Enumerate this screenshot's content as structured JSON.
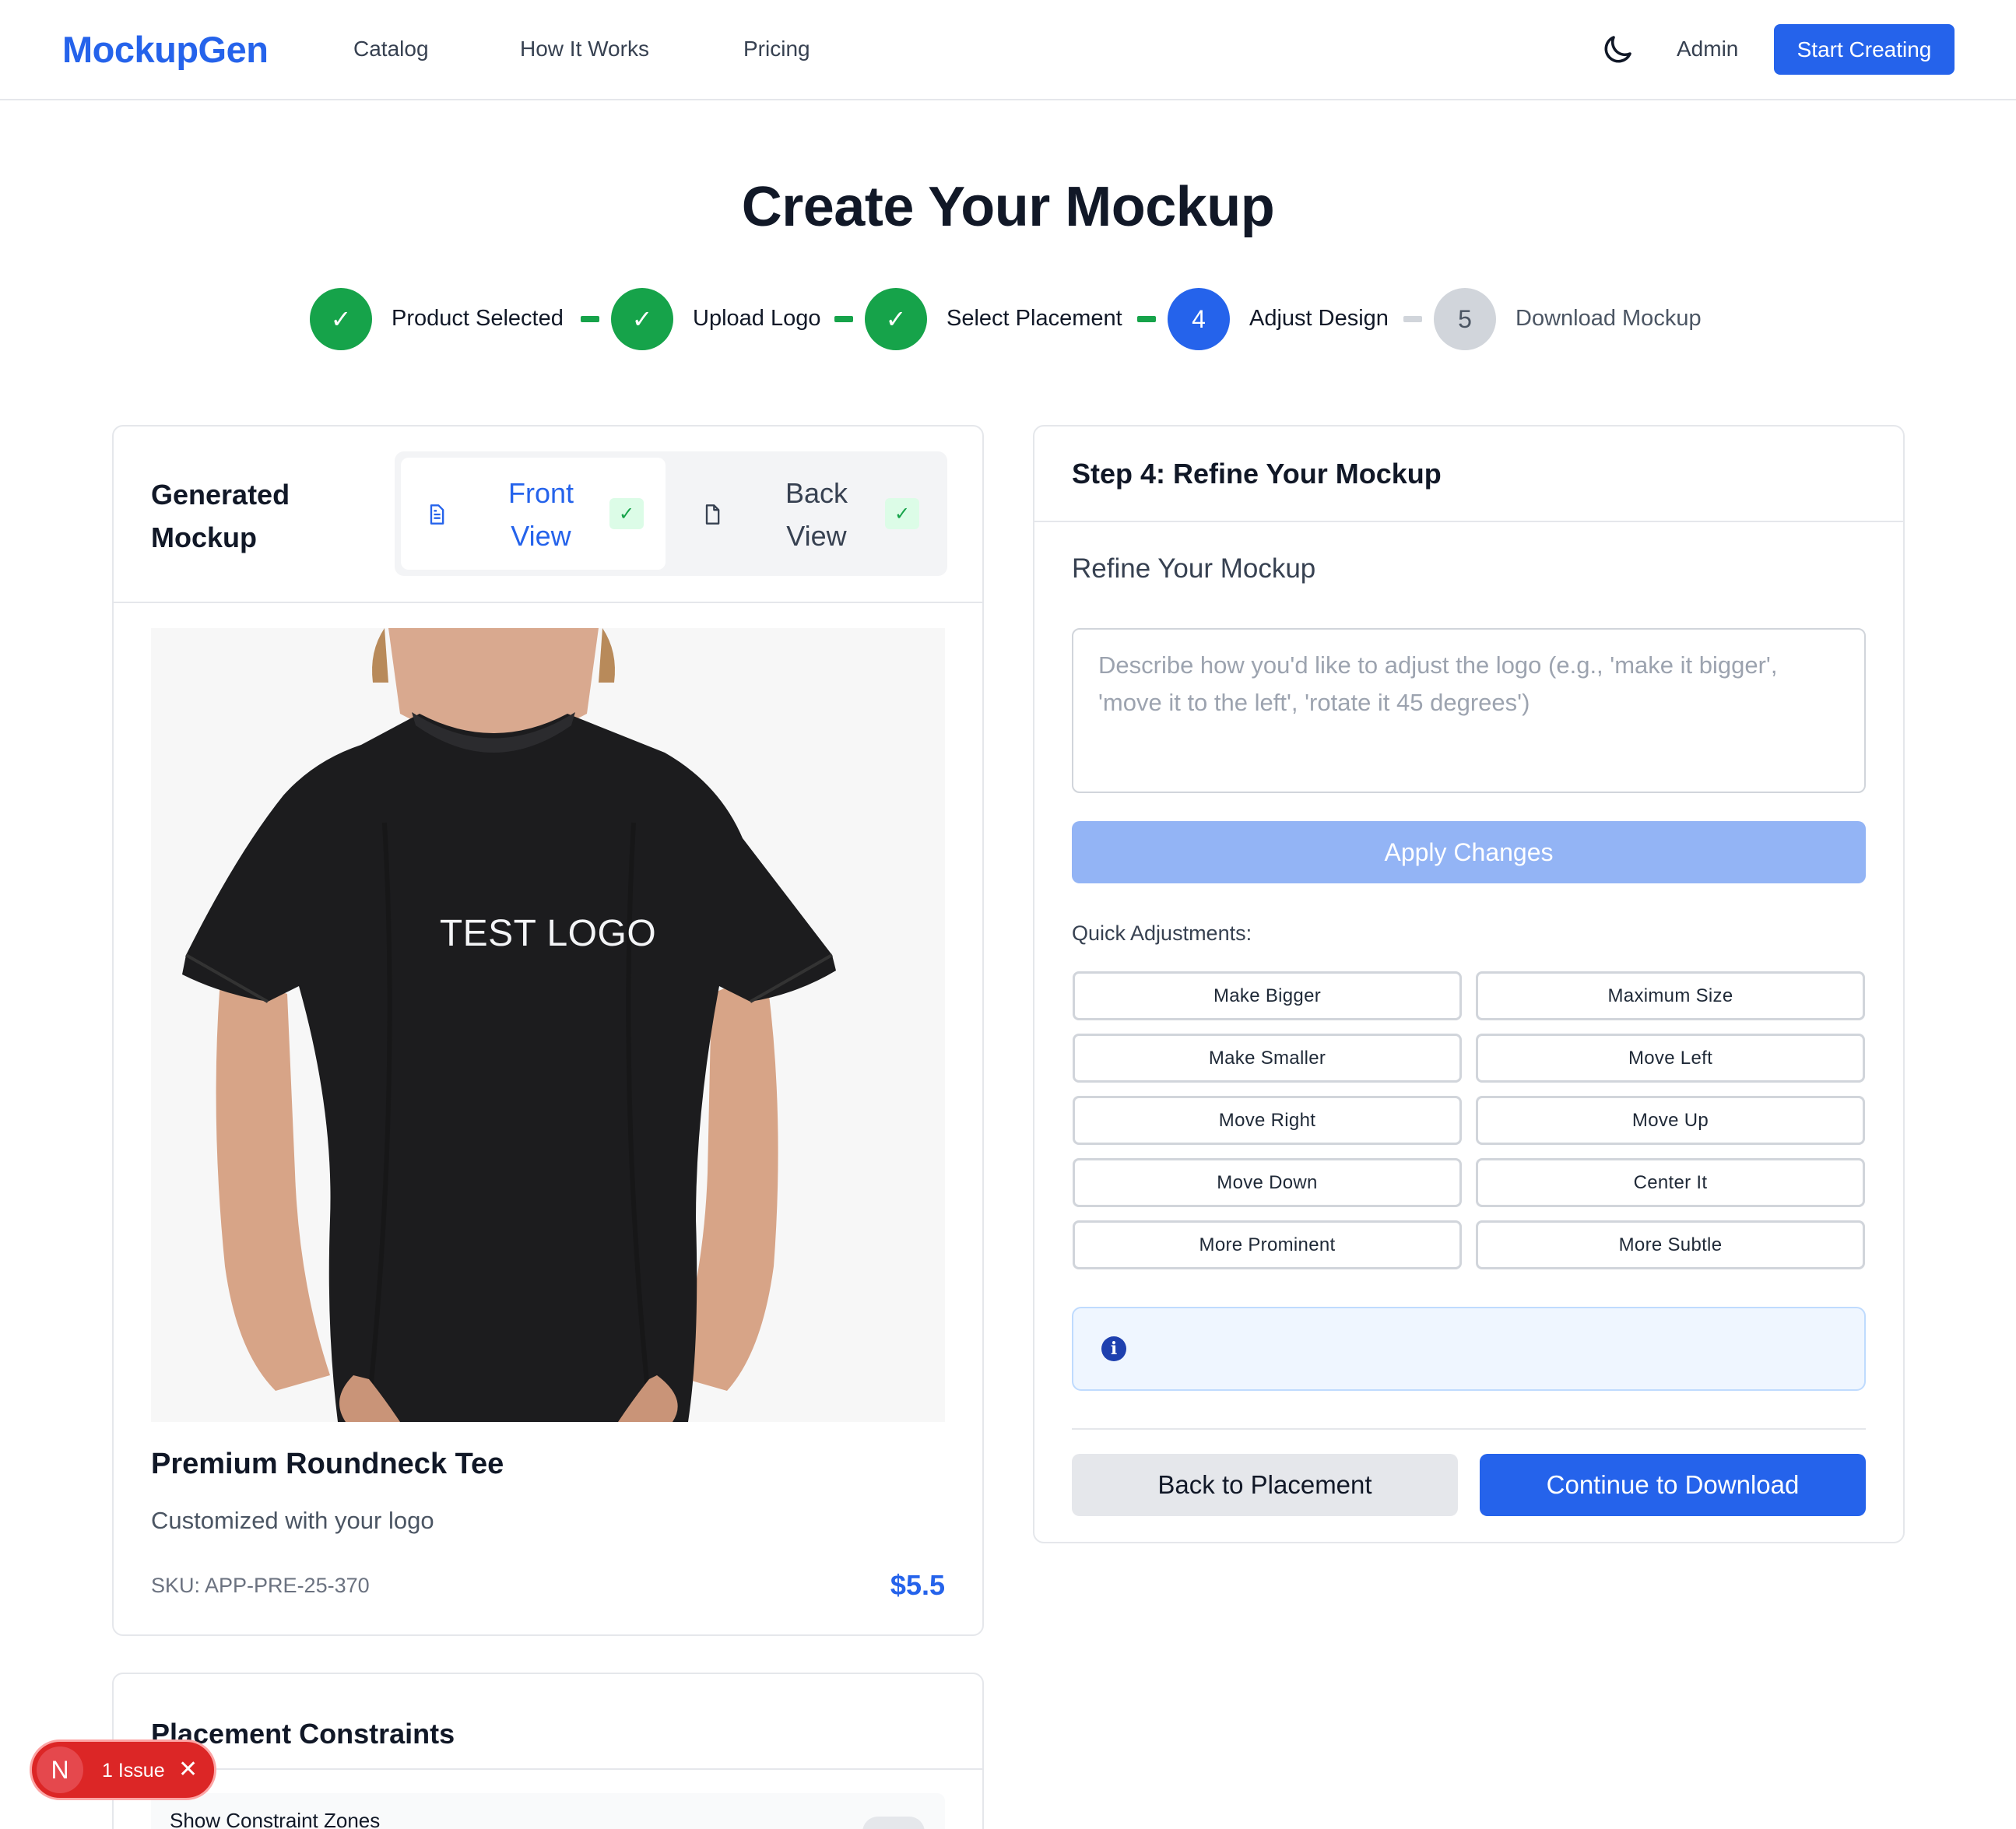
{
  "nav": {
    "brand": "MockupGen",
    "links": [
      "Catalog",
      "How It Works",
      "Pricing"
    ],
    "theme_icon": "moon-icon",
    "admin": "Admin",
    "cta": "Start Creating"
  },
  "page": {
    "title": "Create Your Mockup"
  },
  "steps": [
    {
      "label": "Product Selected",
      "status": "done",
      "marker": "✓"
    },
    {
      "label": "Upload Logo",
      "status": "done",
      "marker": "✓"
    },
    {
      "label": "Select Placement",
      "status": "done",
      "marker": "✓"
    },
    {
      "label": "Adjust Design",
      "status": "active",
      "marker": "4"
    },
    {
      "label": "Download Mockup",
      "status": "todo",
      "marker": "5"
    }
  ],
  "mockup": {
    "title_line1": "Generated",
    "title_line2": "Mockup",
    "tabs": [
      {
        "line1": "Front",
        "line2": "View",
        "active": true,
        "check": "✓"
      },
      {
        "line1": "Back",
        "line2": "View",
        "active": false,
        "check": "✓"
      }
    ],
    "logo_text": "TEST LOGO",
    "product_name": "Premium Roundneck Tee",
    "product_subtitle": "Customized with your logo",
    "sku": "SKU: APP-PRE-25-370",
    "price": "$5.5"
  },
  "constraints": {
    "title": "Placement Constraints",
    "toggle_label": "Show Constraint Zones"
  },
  "refine": {
    "card_title": "Step 4: Refine Your Mockup",
    "subtitle": "Refine Your Mockup",
    "placeholder": "Describe how you'd like to adjust the logo (e.g., 'make it bigger', 'move it to the left', 'rotate it 45 degrees')",
    "apply": "Apply Changes",
    "quick_label": "Quick Adjustments:",
    "quick": [
      "Make Bigger",
      "Maximum Size",
      "Make Smaller",
      "Move Left",
      "Move Right",
      "Move Up",
      "Move Down",
      "Center It",
      "More Prominent",
      "More Subtle"
    ],
    "info_icon": "info-icon",
    "back": "Back to Placement",
    "continue": "Continue to Download"
  },
  "issues": {
    "badge": "N",
    "text": "1 Issue",
    "close": "✕"
  },
  "colors": {
    "primary": "#2563eb",
    "success": "#16a34a",
    "danger": "#dc2626"
  }
}
